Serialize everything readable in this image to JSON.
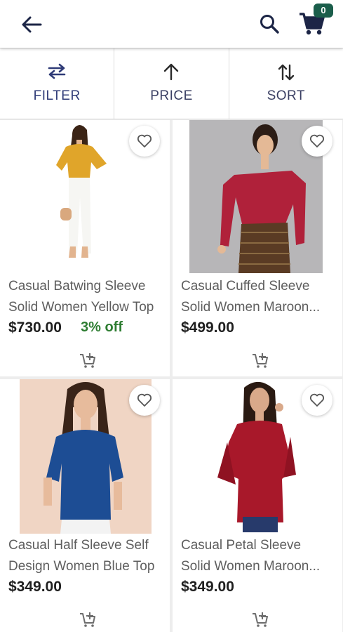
{
  "header": {
    "cart_count": "0",
    "icons": [
      "back-arrow-icon",
      "search-icon",
      "shopping-cart-icon"
    ]
  },
  "filterbar": {
    "filter": "FILTER",
    "price": "PRICE",
    "sort": "SORT"
  },
  "products": [
    {
      "title_line1": "Casual Batwing Sleeve",
      "title_line2": "Solid Women Yellow Top",
      "price": "$730.00",
      "discount": "3% off"
    },
    {
      "title_line1": "Casual Cuffed Sleeve",
      "title_line2": "Solid Women Maroon...",
      "price": "$499.00",
      "discount": ""
    },
    {
      "title_line1": "Casual Half Sleeve Self",
      "title_line2": "Design Women Blue Top",
      "price": "$349.00",
      "discount": ""
    },
    {
      "title_line1": "Casual Petal Sleeve",
      "title_line2": "Solid Women Maroon...",
      "price": "$349.00",
      "discount": ""
    }
  ],
  "colors": {
    "accent": "#2f3b77",
    "discount": "#2e7d32",
    "badge": "#1b5e4b"
  }
}
